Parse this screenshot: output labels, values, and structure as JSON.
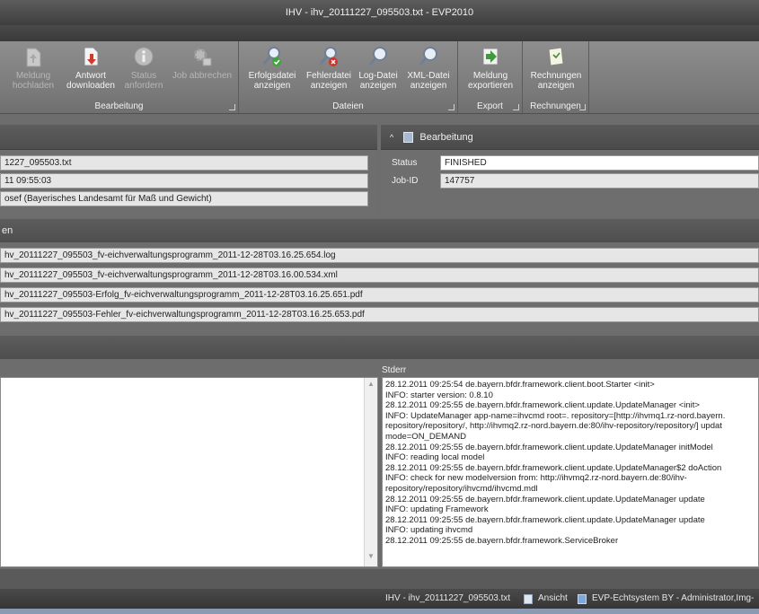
{
  "window": {
    "title": "IHV - ihv_20111227_095503.txt - EVP2010"
  },
  "ribbon": {
    "groups": {
      "bearbeitung": "Bearbeitung",
      "dateien": "Dateien",
      "export": "Export",
      "rechnungen": "Rechnungen"
    },
    "buttons": {
      "meldung_hochladen": "Meldung hochladen",
      "antwort_downloaden": "Antwort downloaden",
      "status_anfordern": "Status anfordern",
      "job_abbrechen": "Job abbrechen",
      "erfolgsdatei": "Erfolgsdatei anzeigen",
      "fehlerdatei": "Fehlerdatei anzeigen",
      "logdatei": "Log-Datei anzeigen",
      "xmldatei": "XML-Datei anzeigen",
      "meldung_exportieren": "Meldung exportieren",
      "rechnungen_anzeigen": "Rechnungen anzeigen"
    }
  },
  "info_panel": {
    "filename": "1227_095503.txt",
    "timestamp": "11 09:55:03",
    "sender": "osef (Bayerisches Landesamt für Maß und Gewicht)"
  },
  "bearbeitung_panel": {
    "header": "Bearbeitung",
    "status_label": "Status",
    "status_value": "FINISHED",
    "jobid_label": "Job-ID",
    "jobid_value": "147757"
  },
  "files_section": {
    "header": "en",
    "files": [
      "hv_20111227_095503_fv-eichverwaltungsprogramm_2011-12-28T03.16.25.654.log",
      "hv_20111227_095503_fv-eichverwaltungsprogramm_2011-12-28T03.16.00.534.xml",
      "hv_20111227_095503-Erfolg_fv-eichverwaltungsprogramm_2011-12-28T03.16.25.651.pdf",
      "hv_20111227_095503-Fehler_fv-eichverwaltungsprogramm_2011-12-28T03.16.25.653.pdf"
    ]
  },
  "stderr": {
    "label": "Stderr",
    "lines": [
      "28.12.2011 09:25:54 de.bayern.bfdr.framework.client.boot.Starter <init>",
      "INFO: starter version: 0.8.10",
      "28.12.2011 09:25:55 de.bayern.bfdr.framework.client.update.UpdateManager <init>",
      "INFO: UpdateManager app-name=ihvcmd root=. repository=[http://ihvmq1.rz-nord.bayern.",
      "repository/repository/, http://ihvmq2.rz-nord.bayern.de:80/ihv-repository/repository/] updat",
      "mode=ON_DEMAND",
      "28.12.2011 09:25:55 de.bayern.bfdr.framework.client.update.UpdateManager initModel",
      "INFO: reading local model",
      "28.12.2011 09:25:55 de.bayern.bfdr.framework.client.update.UpdateManager$2 doAction",
      "INFO: check for new modelversion from: http://ihvmq2.rz-nord.bayern.de:80/ihv-",
      "repository/repository/ihvcmd/ihvcmd.mdl",
      "28.12.2011 09:25:55 de.bayern.bfdr.framework.client.update.UpdateManager update",
      "INFO: updating Framework",
      "28.12.2011 09:25:55 de.bayern.bfdr.framework.client.update.UpdateManager update",
      "INFO: updating ihvcmd",
      "28.12.2011 09:25:55 de.bayern.bfdr.framework.ServiceBroker"
    ]
  },
  "statusbar": {
    "document": "IHV - ihv_20111227_095503.txt",
    "view": "Ansicht",
    "system": "EVP-Echtsystem BY - Administrator,Img-"
  }
}
